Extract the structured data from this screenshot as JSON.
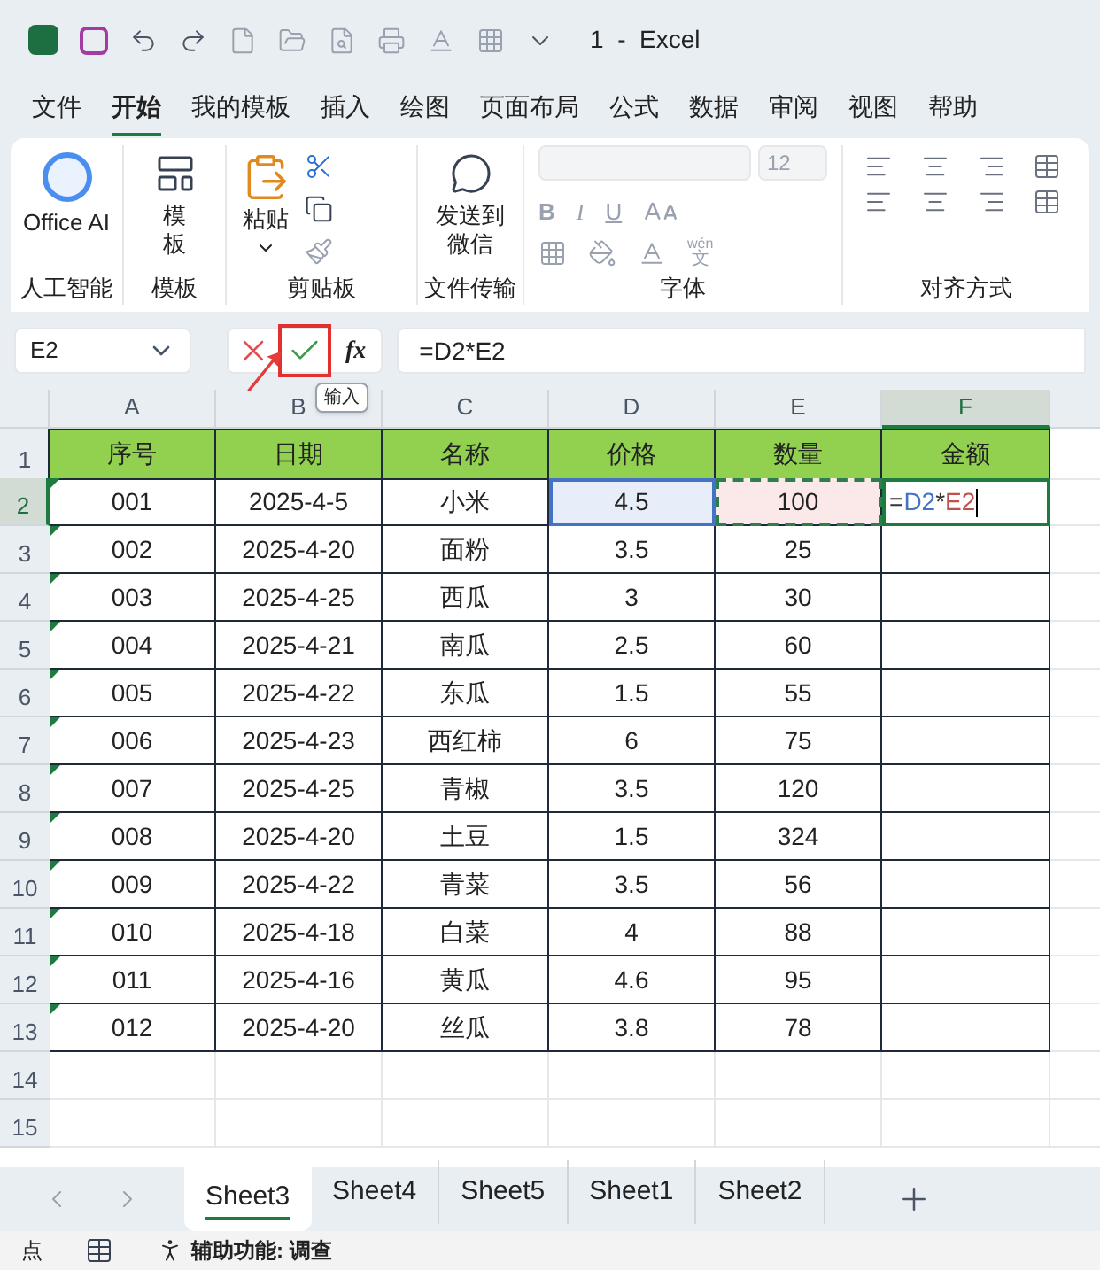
{
  "title_bar": {
    "title": "1  -  Excel"
  },
  "menu_tabs": [
    {
      "label": "文件",
      "selected": false
    },
    {
      "label": "开始",
      "selected": true
    },
    {
      "label": "我的模板",
      "selected": false
    },
    {
      "label": "插入",
      "selected": false
    },
    {
      "label": "绘图",
      "selected": false
    },
    {
      "label": "页面布局",
      "selected": false
    },
    {
      "label": "公式",
      "selected": false
    },
    {
      "label": "数据",
      "selected": false
    },
    {
      "label": "审阅",
      "selected": false
    },
    {
      "label": "视图",
      "selected": false
    },
    {
      "label": "帮助",
      "selected": false
    }
  ],
  "ribbon": {
    "ai_button": "Office AI",
    "ai_group": "人工智能",
    "template_button": "模板",
    "template_group": "模板",
    "paste_button": "粘贴",
    "clipboard_group": "剪贴板",
    "wechat_button": "发送到微信",
    "transfer_group": "文件传输",
    "font_size": "12",
    "bold": "B",
    "italic": "I",
    "underline": "U",
    "phonetic_top": "wén",
    "phonetic_bottom": "文",
    "font_group": "字体",
    "align_group": "对齐方式"
  },
  "formula_bar": {
    "name_box": "E2",
    "function_symbol": "fx",
    "formula": "=D2*E2",
    "enter_highlighted": true,
    "tooltip": "输入"
  },
  "grid": {
    "columns": [
      {
        "letter": "A",
        "selected": false
      },
      {
        "letter": "B",
        "selected": false
      },
      {
        "letter": "C",
        "selected": false
      },
      {
        "letter": "D",
        "selected": false
      },
      {
        "letter": "E",
        "selected": false
      },
      {
        "letter": "F",
        "selected": true
      }
    ],
    "header_row": {
      "number": "1",
      "cells": [
        "序号",
        "日期",
        "名称",
        "价格",
        "数量",
        "金额"
      ]
    },
    "rows": [
      {
        "number": "2",
        "selected": true,
        "flagged": true,
        "cells": [
          "001",
          "2025-4-5",
          "小米",
          "4.5",
          "100"
        ]
      },
      {
        "number": "3",
        "selected": false,
        "flagged": true,
        "cells": [
          "002",
          "2025-4-20",
          "面粉",
          "3.5",
          "25"
        ]
      },
      {
        "number": "4",
        "selected": false,
        "flagged": true,
        "cells": [
          "003",
          "2025-4-25",
          "西瓜",
          "3",
          "30"
        ]
      },
      {
        "number": "5",
        "selected": false,
        "flagged": true,
        "cells": [
          "004",
          "2025-4-21",
          "南瓜",
          "2.5",
          "60"
        ]
      },
      {
        "number": "6",
        "selected": false,
        "flagged": true,
        "cells": [
          "005",
          "2025-4-22",
          "东瓜",
          "1.5",
          "55"
        ]
      },
      {
        "number": "7",
        "selected": false,
        "flagged": true,
        "cells": [
          "006",
          "2025-4-23",
          "西红柿",
          "6",
          "75"
        ]
      },
      {
        "number": "8",
        "selected": false,
        "flagged": true,
        "cells": [
          "007",
          "2025-4-25",
          "青椒",
          "3.5",
          "120"
        ]
      },
      {
        "number": "9",
        "selected": false,
        "flagged": true,
        "cells": [
          "008",
          "2025-4-20",
          "土豆",
          "1.5",
          "324"
        ]
      },
      {
        "number": "10",
        "selected": false,
        "flagged": true,
        "cells": [
          "009",
          "2025-4-22",
          "青菜",
          "3.5",
          "56"
        ]
      },
      {
        "number": "11",
        "selected": false,
        "flagged": true,
        "cells": [
          "010",
          "2025-4-18",
          "白菜",
          "4",
          "88"
        ]
      },
      {
        "number": "12",
        "selected": false,
        "flagged": true,
        "cells": [
          "011",
          "2025-4-16",
          "黄瓜",
          "4.6",
          "95"
        ]
      },
      {
        "number": "13",
        "selected": false,
        "flagged": true,
        "cells": [
          "012",
          "2025-4-20",
          "丝瓜",
          "3.8",
          "78"
        ]
      }
    ],
    "editing_formula": [
      {
        "text": "=",
        "color": "#333333"
      },
      {
        "text": "D2",
        "color": "#4472c4"
      },
      {
        "text": "*",
        "color": "#333333"
      },
      {
        "text": "E2",
        "color": "#c0504d"
      }
    ],
    "empty_rows": [
      "14",
      "15"
    ]
  },
  "sheet_tabs": [
    {
      "label": "Sheet3",
      "selected": true
    },
    {
      "label": "Sheet4",
      "selected": false
    },
    {
      "label": "Sheet5",
      "selected": false
    },
    {
      "label": "Sheet1",
      "selected": false
    },
    {
      "label": "Sheet2",
      "selected": false
    }
  ],
  "status_bar": {
    "mode": "点",
    "accessibility": "辅助功能: 调查"
  }
}
